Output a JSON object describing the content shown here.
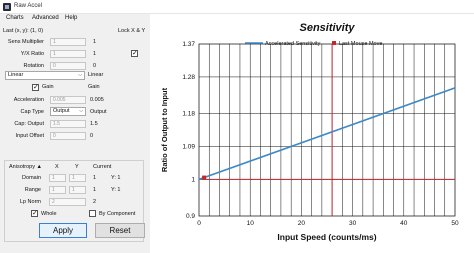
{
  "window": {
    "title": "Raw Accel"
  },
  "menu": {
    "items": [
      "Charts",
      "Advanced",
      "Help"
    ]
  },
  "settings": {
    "last_xy": "Last (x, y): (1, 0)",
    "lock_xy": "Lock X & Y",
    "sens_multiplier": {
      "label": "Sens Multiplier",
      "placeholder": "1",
      "current": "1"
    },
    "yx_ratio": {
      "label": "Y/X Ratio",
      "placeholder": "1",
      "current": "1"
    },
    "rotation": {
      "label": "Rotation",
      "placeholder": "0",
      "current": "0"
    },
    "accel_type": {
      "selected": "Linear",
      "current": "Linear"
    },
    "gain": {
      "label": "Gain",
      "current": "Gain"
    },
    "acceleration": {
      "label": "Acceleration",
      "placeholder": "0.005",
      "current": "0.005"
    },
    "cap_type": {
      "label": "Cap Type",
      "selected": "Output",
      "current": "Output"
    },
    "cap_output": {
      "label": "Cap: Output",
      "placeholder": "1.5",
      "current": "1.5"
    },
    "input_offset": {
      "label": "Input Offset",
      "placeholder": "0",
      "current": "0"
    }
  },
  "anisotropy": {
    "title": "Anisotropy ▲",
    "col_x": "X",
    "col_y": "Y",
    "col_current": "Current",
    "domain": {
      "label": "Domain",
      "x": "1",
      "y": "1",
      "current": "1",
      "current2": "Y: 1"
    },
    "range": {
      "label": "Range",
      "x": "1",
      "y": "1",
      "current": "1",
      "current2": "Y: 1"
    },
    "lp_norm": {
      "label": "Lp Norm",
      "value": "2",
      "current": "2"
    },
    "whole": "Whole",
    "by_component": "By Component"
  },
  "buttons": {
    "apply": "Apply",
    "reset": "Reset"
  },
  "chart_data": {
    "type": "line",
    "title": "Sensitivity",
    "xlabel": "Input Speed (counts/ms)",
    "ylabel": "Ratio of Output to Input",
    "xlim": [
      0,
      50
    ],
    "ylim": [
      0.9,
      1.37
    ],
    "x_ticks": [
      0,
      10,
      20,
      30,
      40,
      50
    ],
    "y_ticks": [
      0.9,
      1,
      1.09,
      1.18,
      1.28,
      1.37
    ],
    "y_tick_labels": [
      "0.9",
      "1",
      "1.09",
      "1.18",
      "1.28",
      "1.37"
    ],
    "grid": true,
    "legend": "top",
    "series": [
      {
        "name": "Accelerated Sensitivity",
        "color": "#3c88c8",
        "x": [
          0,
          50
        ],
        "y": [
          1.0,
          1.25
        ]
      },
      {
        "name": "Last Mouse Move",
        "color": "#c0282d",
        "type": "marker",
        "x": [
          1
        ],
        "y": [
          1.005
        ],
        "vline_x": 26,
        "hline_y": 1.0
      }
    ]
  }
}
